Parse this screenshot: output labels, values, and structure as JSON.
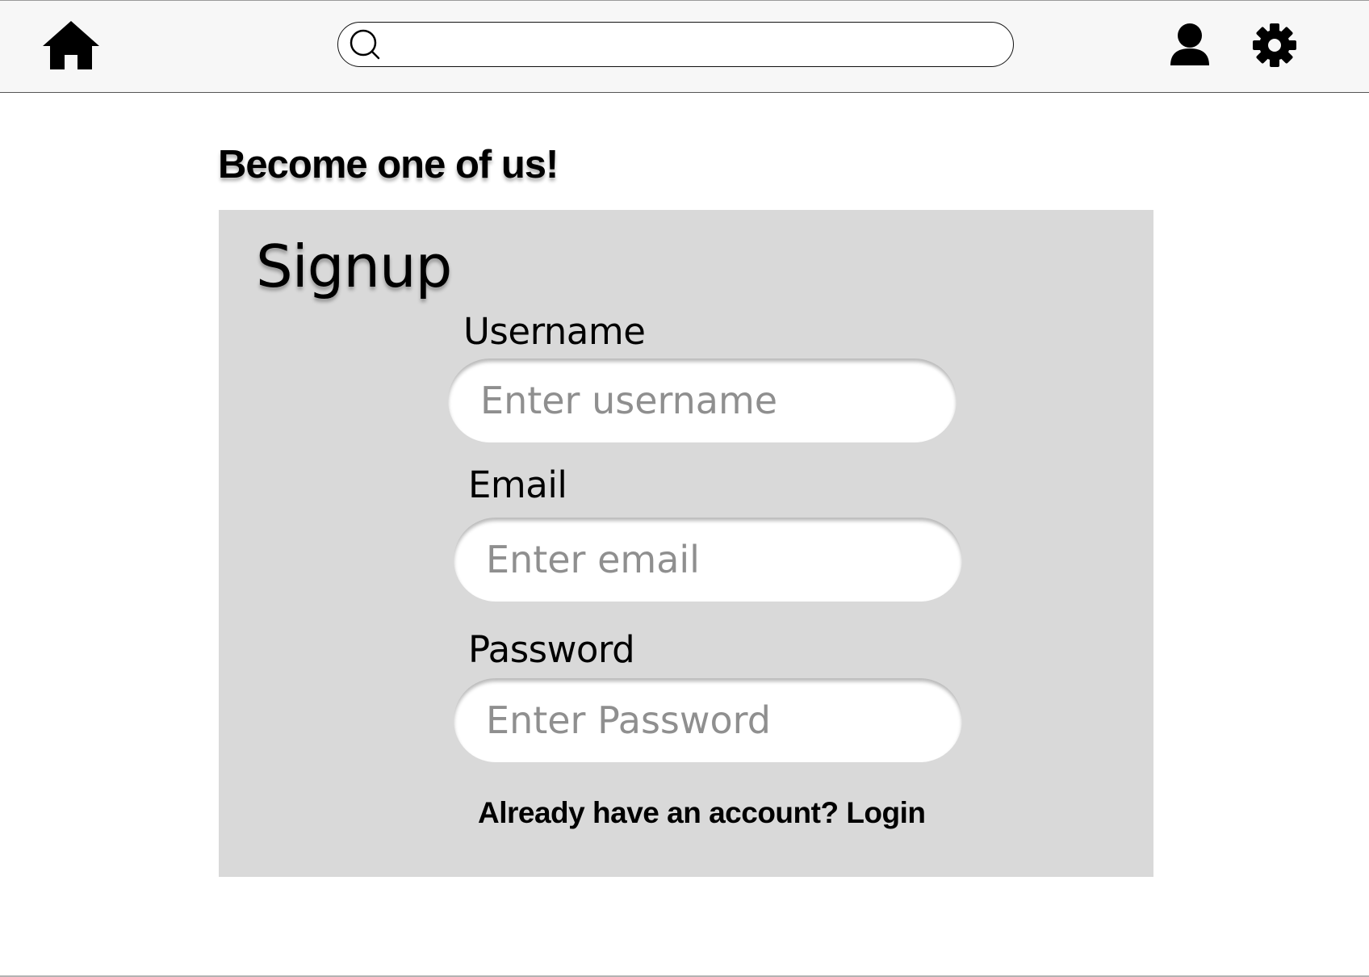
{
  "header": {
    "home_icon": "home-icon",
    "search": {
      "icon": "search-icon",
      "value": "",
      "placeholder": ""
    },
    "user_icon": "user-icon",
    "settings_icon": "gear-icon"
  },
  "main": {
    "tagline": "Become one of us!",
    "form": {
      "title": "Signup",
      "username_label": "Username",
      "username_placeholder": "Enter username",
      "email_label": "Email",
      "email_placeholder": "Enter email",
      "password_label": "Password",
      "password_placeholder": "Enter Password",
      "login_prompt": "Already have an account?",
      "login_link": "Login"
    }
  },
  "colors": {
    "header_bg": "#f7f7f7",
    "panel_bg": "#d9d9d9",
    "input_bg": "#ffffff",
    "placeholder_text": "#8f8f8f",
    "text": "#000000"
  }
}
